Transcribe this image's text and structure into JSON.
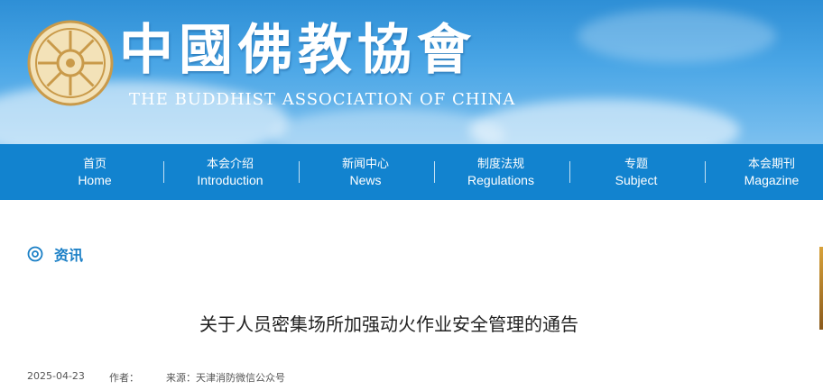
{
  "header": {
    "title_cn": "中國佛教協會",
    "title_en": "THE BUDDHIST ASSOCIATION OF CHINA",
    "logo_icon": "dharma-wheel-icon"
  },
  "nav": {
    "items": [
      {
        "cn": "首页",
        "en": "Home"
      },
      {
        "cn": "本会介绍",
        "en": "Introduction"
      },
      {
        "cn": "新闻中心",
        "en": "News"
      },
      {
        "cn": "制度法规",
        "en": "Regulations"
      },
      {
        "cn": "专题",
        "en": "Subject"
      },
      {
        "cn": "本会期刊",
        "en": "Magazine"
      }
    ]
  },
  "section": {
    "title": "资讯",
    "icon": "target-icon"
  },
  "article": {
    "title": "关于人员密集场所加强动火作业安全管理的通告",
    "date": "2025-04-23",
    "author_label": "作者：",
    "source_label": "来源：",
    "source_value": "天津消防微信公众号"
  },
  "colors": {
    "banner_top": "#2e8fd6",
    "nav_bg": "#1283cf",
    "section_accent": "#1a7fc6"
  }
}
